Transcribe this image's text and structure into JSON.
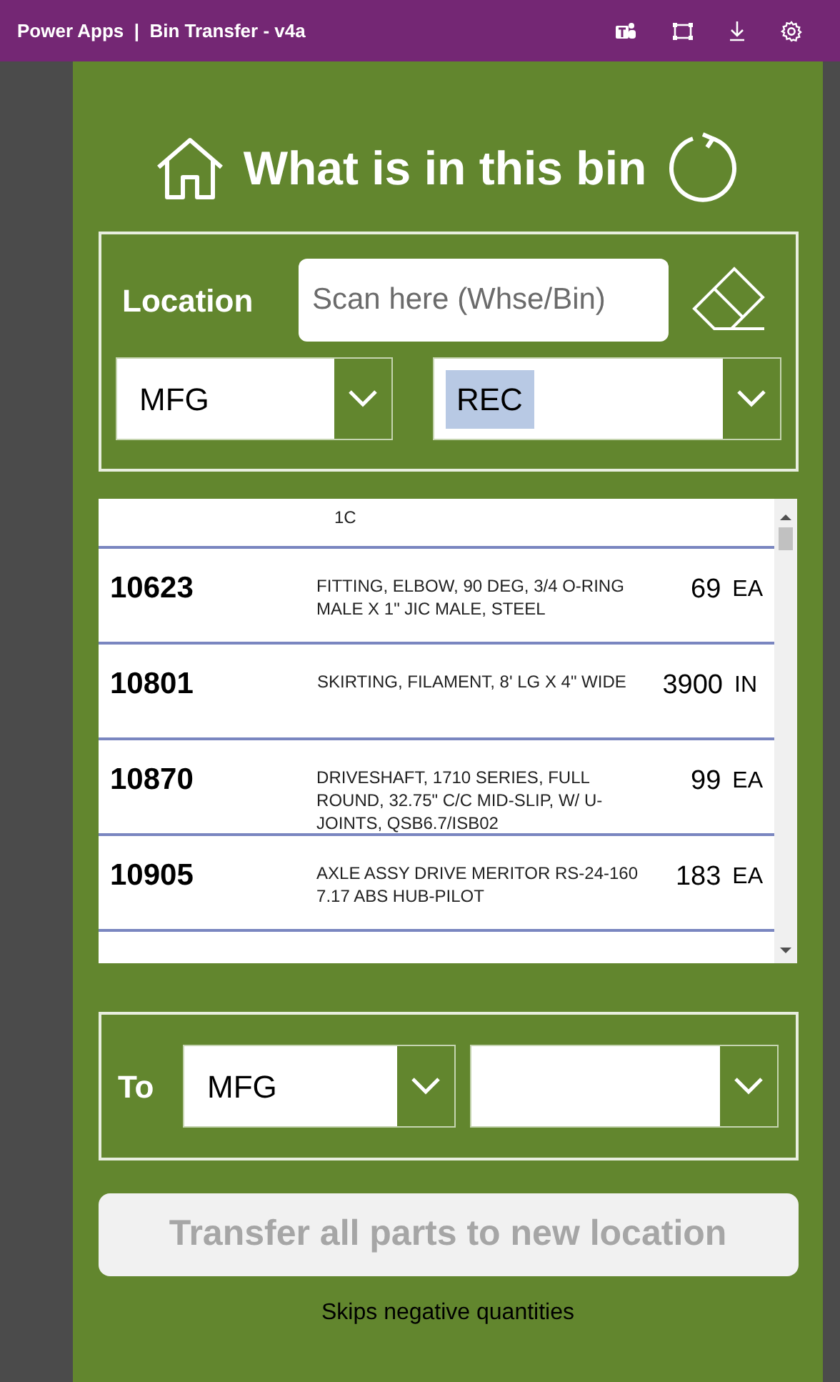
{
  "app_bar": {
    "app": "Power Apps",
    "separator": "|",
    "title": "Bin Transfer - v4a"
  },
  "header": {
    "title": "What is in this bin"
  },
  "location": {
    "label": "Location",
    "scan_field": {
      "placeholder": "Scan here (Whse/Bin)"
    },
    "warehouse": {
      "value": "MFG",
      "text_selected": false
    },
    "bin": {
      "value": "REC",
      "text_selected": true
    }
  },
  "parts": {
    "top_partial_row": {
      "description": "1C"
    },
    "rows": [
      {
        "part": "10623",
        "description": "FITTING, ELBOW, 90 DEG, 3/4 O-RING MALE X 1\" JIC MALE, STEEL",
        "qty": "69",
        "unit": "EA"
      },
      {
        "part": "10801",
        "description": "SKIRTING, FILAMENT, 8' LG X 4\" WIDE",
        "qty": "3900",
        "unit": "IN"
      },
      {
        "part": "10870",
        "description": "DRIVESHAFT, 1710 SERIES, FULL ROUND, 32.75\" C/C MID-SLIP, W/ U-JOINTS, QSB6.7/ISB02",
        "qty": "99",
        "unit": "EA"
      },
      {
        "part": "10905",
        "description": "AXLE ASSY DRIVE MERITOR RS-24-160 7.17 ABS HUB-PILOT",
        "qty": "183",
        "unit": "EA"
      }
    ]
  },
  "to": {
    "label": "To",
    "warehouse": {
      "value": "MFG"
    }
  },
  "transfer_button": {
    "label": "Transfer all parts to new location",
    "disabled": true
  },
  "note": "Skips negative quantities"
}
